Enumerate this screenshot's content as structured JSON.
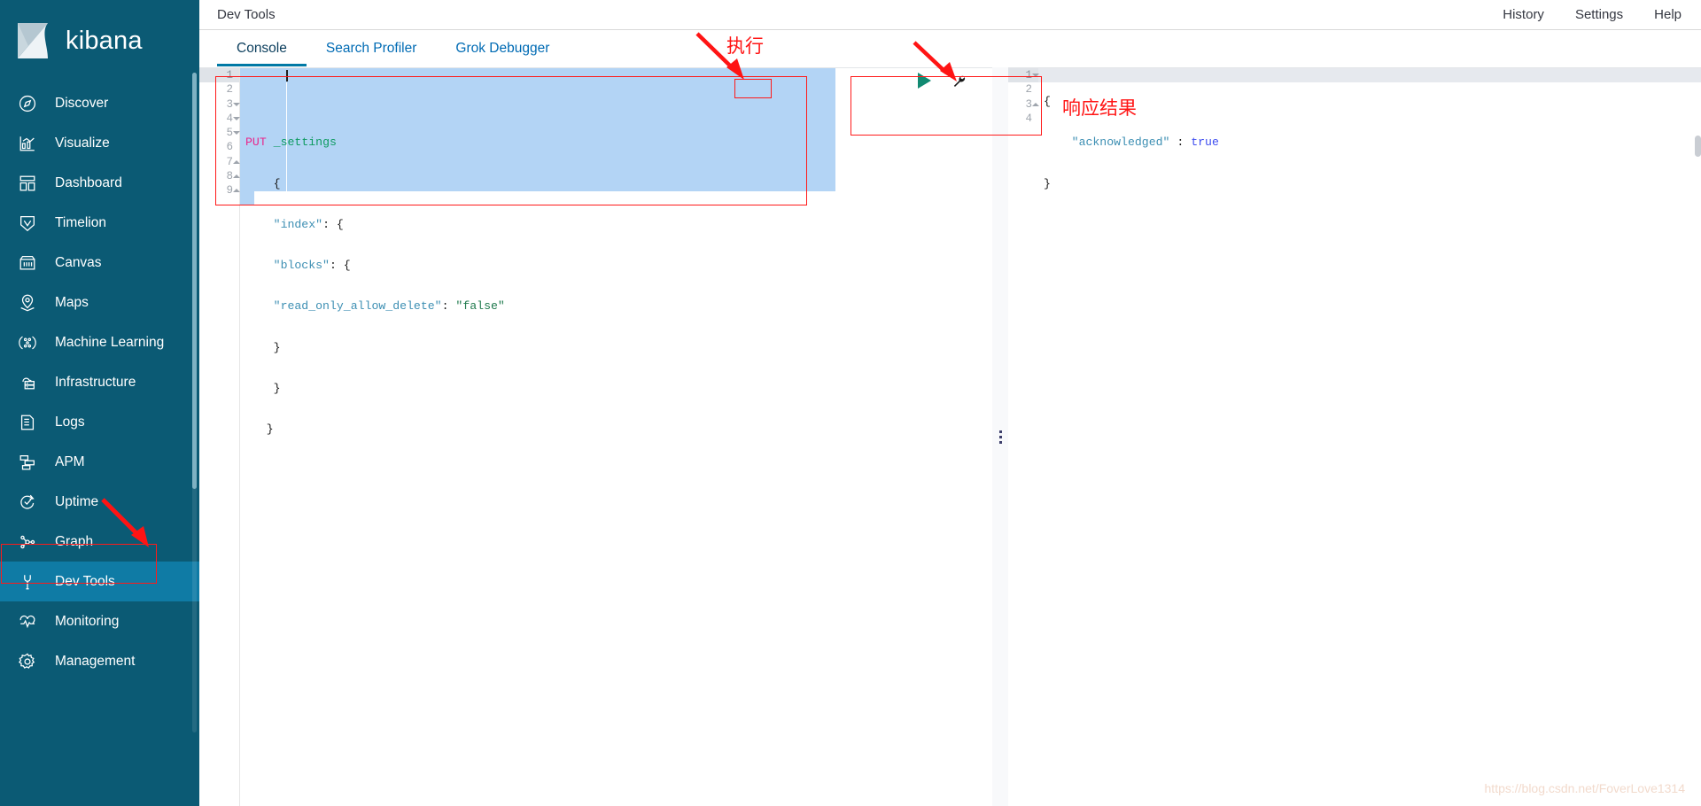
{
  "brand": {
    "name": "kibana",
    "logo_icon": "kibana-logo-icon"
  },
  "sidebar": {
    "items": [
      {
        "label": "Discover",
        "icon": "compass-icon",
        "active": false
      },
      {
        "label": "Visualize",
        "icon": "bar-chart-icon",
        "active": false
      },
      {
        "label": "Dashboard",
        "icon": "dashboard-grid-icon",
        "active": false
      },
      {
        "label": "Timelion",
        "icon": "timelion-icon",
        "active": false
      },
      {
        "label": "Canvas",
        "icon": "canvas-icon",
        "active": false
      },
      {
        "label": "Maps",
        "icon": "map-pin-icon",
        "active": false
      },
      {
        "label": "Machine Learning",
        "icon": "machine-learning-icon",
        "active": false
      },
      {
        "label": "Infrastructure",
        "icon": "infrastructure-icon",
        "active": false
      },
      {
        "label": "Logs",
        "icon": "logs-icon",
        "active": false
      },
      {
        "label": "APM",
        "icon": "apm-icon",
        "active": false
      },
      {
        "label": "Uptime",
        "icon": "uptime-icon",
        "active": false
      },
      {
        "label": "Graph",
        "icon": "graph-icon",
        "active": false
      },
      {
        "label": "Dev Tools",
        "icon": "wrench-icon",
        "active": true
      },
      {
        "label": "Monitoring",
        "icon": "heartbeat-icon",
        "active": false
      },
      {
        "label": "Management",
        "icon": "gear-icon",
        "active": false
      }
    ]
  },
  "header": {
    "title": "Dev Tools",
    "links": [
      {
        "label": "History"
      },
      {
        "label": "Settings"
      },
      {
        "label": "Help"
      }
    ]
  },
  "tabs": [
    {
      "label": "Console",
      "active": true
    },
    {
      "label": "Search Profiler",
      "active": false
    },
    {
      "label": "Grok Debugger",
      "active": false
    }
  ],
  "editor": {
    "actions": {
      "play_label": "play-request",
      "wrench_label": "request-options"
    },
    "line_numbers": [
      "1",
      "2",
      "3",
      "4",
      "5",
      "6",
      "7",
      "8",
      "9"
    ],
    "folds": {
      "3": "down",
      "4": "down",
      "5": "down",
      "7": "up",
      "8": "up",
      "9": "up"
    },
    "lines": [
      {
        "n": 1,
        "text": ""
      },
      {
        "n": 2,
        "method": "PUT",
        "url": "_settings"
      },
      {
        "n": 3,
        "text": "    {"
      },
      {
        "n": 4,
        "key": "\"index\"",
        "rest": ": {",
        "indent": "    "
      },
      {
        "n": 5,
        "key": "\"blocks\"",
        "rest": ": {",
        "indent": "    "
      },
      {
        "n": 6,
        "key": "\"read_only_allow_delete\"",
        "rest": ": ",
        "value": "\"false\"",
        "indent": "    "
      },
      {
        "n": 7,
        "text": "    }"
      },
      {
        "n": 8,
        "text": "    }"
      },
      {
        "n": 9,
        "text": "   }"
      }
    ],
    "raw": "PUT _settings\n    {\n    \"index\": {\n    \"blocks\": {\n    \"read_only_allow_delete\": \"false\"\n    }\n    }\n   }"
  },
  "response": {
    "line_numbers": [
      "1",
      "2",
      "3",
      "4"
    ],
    "folds": {
      "1": "down",
      "3": "up"
    },
    "lines": [
      {
        "n": 1,
        "text": "{"
      },
      {
        "n": 2,
        "key": "\"acknowledged\"",
        "sep": " : ",
        "value": "true"
      },
      {
        "n": 3,
        "text": "}"
      },
      {
        "n": 4,
        "text": ""
      }
    ],
    "raw": "{\n    \"acknowledged\" : true\n}"
  },
  "annotations": [
    {
      "name": "execute-annotation",
      "text": "执行"
    },
    {
      "name": "response-annotation",
      "text": "响应结果"
    }
  ],
  "watermark": {
    "text": "https://blog.csdn.net/FoverLove1314"
  },
  "colors": {
    "sidebar_bg": "#0b5a74",
    "sidebar_active": "#0f7ba5",
    "accent": "#0079a5",
    "link": "#006bb4",
    "annotation_red": "#ff1414",
    "selection_blue": "#b3d4f5",
    "play_green": "#128a72"
  }
}
